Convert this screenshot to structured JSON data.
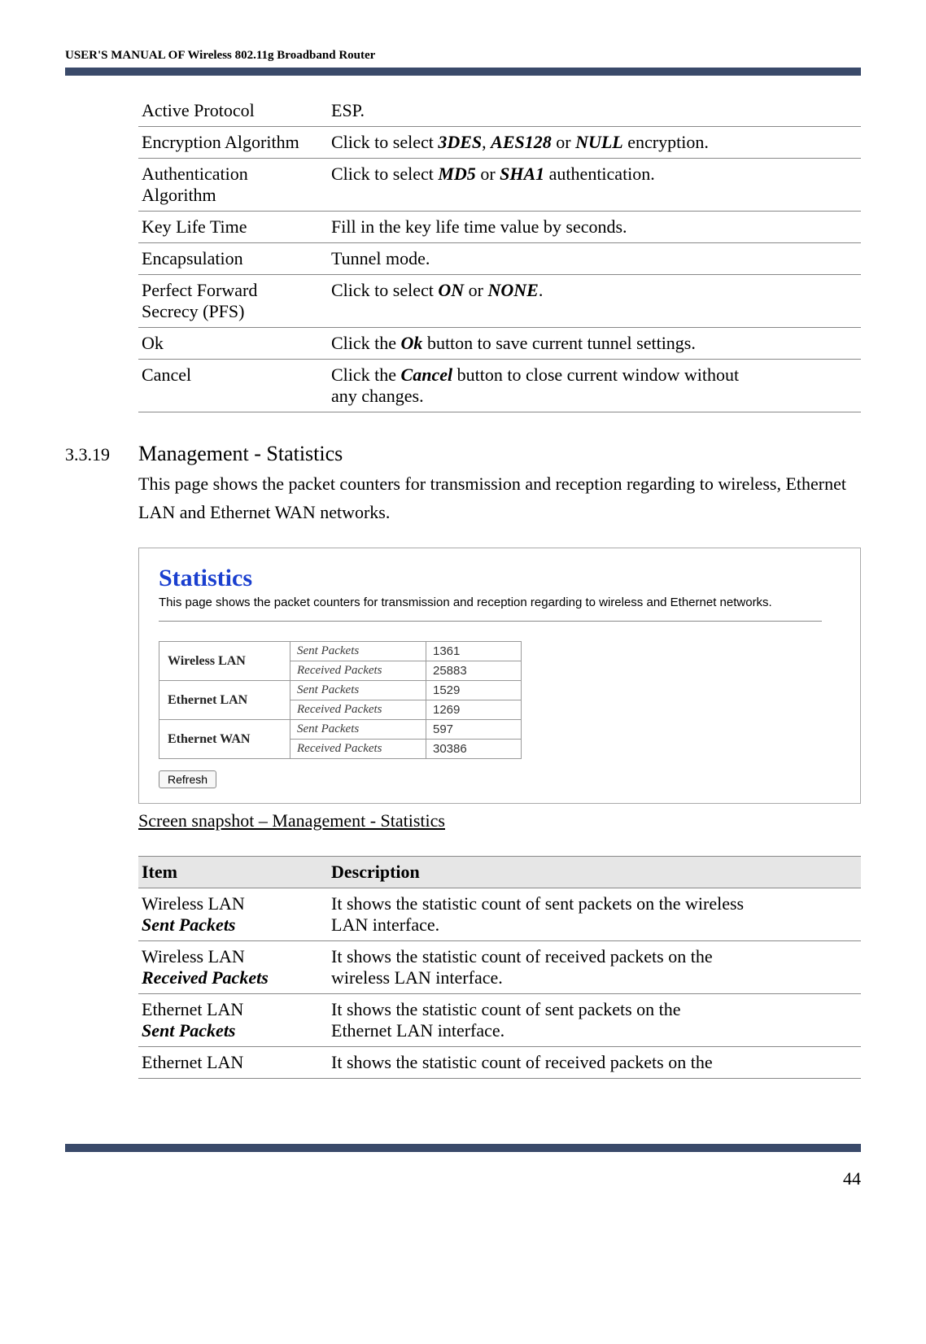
{
  "header": {
    "running": "USER'S MANUAL OF Wireless 802.11g Broadband Router"
  },
  "table1": {
    "rows": [
      {
        "key": "Active Protocol",
        "desc_parts": [
          "ESP."
        ]
      },
      {
        "key": "Encryption Algorithm",
        "desc_parts": [
          "Click to select ",
          "3DES",
          ", ",
          "AES128",
          " or ",
          "NULL",
          " encryption."
        ]
      },
      {
        "key": "Authentication",
        "key2": "Algorithm",
        "desc_parts": [
          "Click to select ",
          "MD5",
          " or ",
          "SHA1",
          " authentication."
        ]
      },
      {
        "key": "Key Life Time",
        "desc_parts": [
          "Fill in the key life time value by seconds."
        ]
      },
      {
        "key": "Encapsulation",
        "desc_parts": [
          "Tunnel mode."
        ]
      },
      {
        "key": "Perfect Forward",
        "key2": "Secrecy (PFS)",
        "desc_parts": [
          "Click to select ",
          "ON",
          " or ",
          "NONE",
          "."
        ]
      },
      {
        "key": "Ok",
        "desc_parts": [
          "Click the ",
          "Ok",
          " button to save current tunnel settings."
        ]
      },
      {
        "key": "Cancel",
        "desc_parts": [
          "Click the ",
          "Cancel",
          " button to close current window without"
        ],
        "desc_line2": "any changes."
      }
    ]
  },
  "section": {
    "number": "3.3.19",
    "title": "Management - Statistics",
    "body": "This page shows the packet counters for transmission and reception regarding to wireless, Ethernet LAN and Ethernet WAN networks."
  },
  "screenshot": {
    "title": "Statistics",
    "desc": "This page shows the packet counters for transmission and reception regarding to wireless and Ethernet networks.",
    "groups": [
      {
        "name": "Wireless LAN",
        "sent_label": "Sent Packets",
        "sent": "1361",
        "recv_label": "Received Packets",
        "recv": "25883"
      },
      {
        "name": "Ethernet LAN",
        "sent_label": "Sent Packets",
        "sent": "1529",
        "recv_label": "Received Packets",
        "recv": "1269"
      },
      {
        "name": "Ethernet WAN",
        "sent_label": "Sent Packets",
        "sent": "597",
        "recv_label": "Received Packets",
        "recv": "30386"
      }
    ],
    "refresh": "Refresh"
  },
  "caption": "Screen snapshot – Management - Statistics",
  "table2": {
    "head": {
      "item": "Item",
      "desc": "Description"
    },
    "rows": [
      {
        "item1": "Wireless LAN",
        "item2": "Sent Packets",
        "desc1": "It shows the statistic count of sent packets on the wireless",
        "desc2": "LAN interface."
      },
      {
        "item1": "Wireless LAN",
        "item2": "Received Packets",
        "desc1": "It shows the statistic count of received packets on the",
        "desc2": "wireless LAN interface."
      },
      {
        "item1": "Ethernet LAN",
        "item2": "Sent Packets",
        "desc1": "It shows the statistic count of sent packets on the",
        "desc2": "Ethernet LAN interface."
      },
      {
        "item1": "Ethernet LAN",
        "item2": "",
        "desc1": "It shows the statistic count of received packets on the",
        "desc2": ""
      }
    ]
  },
  "page_number": "44"
}
